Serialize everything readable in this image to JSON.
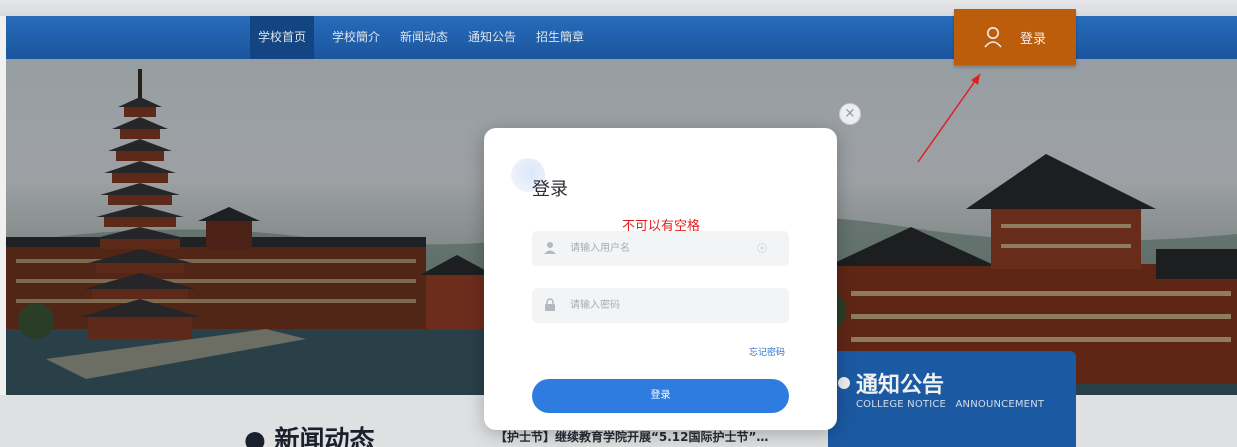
{
  "nav": {
    "items": [
      {
        "label": "学校首页",
        "active": true
      },
      {
        "label": "学校簡介",
        "active": false
      },
      {
        "label": "新闻动态",
        "active": false
      },
      {
        "label": "通知公告",
        "active": false
      },
      {
        "label": "招生簡章",
        "active": false
      }
    ],
    "login_label": "登录"
  },
  "news": {
    "section_title": "● 新闻动态",
    "headline": "【护士节】继续教育学院开展“5.12国际护士节”…"
  },
  "notice": {
    "title": "通知公告",
    "sub_primary": "COLLEGE NOTICE",
    "sub_secondary": "ANNOUNCEMENT"
  },
  "modal": {
    "title": "登录",
    "warning": "不可以有空格",
    "username_placeholder": "请输入用户名",
    "password_placeholder": "请输入密码",
    "forgot_label": "忘记密码",
    "submit_label": "登录",
    "close_symbol": "×"
  },
  "icons": {
    "user_icon": "user-icon",
    "lock_icon": "lock-icon",
    "close_icon": "close-icon"
  },
  "colors": {
    "nav_blue": "#1c5ba8",
    "login_orange": "#c8630c",
    "notice_blue": "#1e5fae",
    "submit_blue": "#2f7ce0",
    "warning_red": "#e02020",
    "annotation_red": "#e02020"
  }
}
